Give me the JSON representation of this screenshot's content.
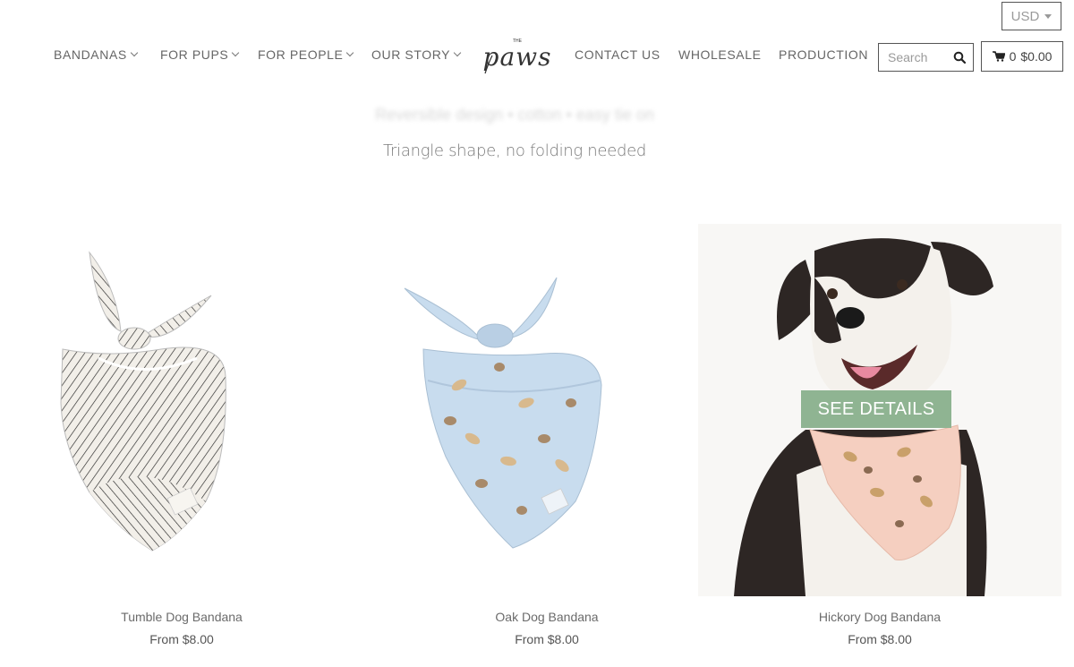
{
  "currency": {
    "label": "USD"
  },
  "nav": {
    "left": [
      {
        "label": "BANDANAS"
      },
      {
        "label": "FOR PUPS"
      },
      {
        "label": "FOR PEOPLE"
      },
      {
        "label": "OUR STORY"
      }
    ],
    "logo": {
      "small": "THE",
      "main": "paws"
    },
    "right": [
      {
        "label": "CONTACT US"
      },
      {
        "label": "WHOLESALE"
      },
      {
        "label": "PRODUCTION"
      }
    ],
    "search_placeholder": "Search",
    "cart": {
      "count": "0",
      "total": "$0.00"
    }
  },
  "section": {
    "faded_heading": "Reversible design • cotton • easy tie on",
    "subtitle": "Triangle shape, no folding needed"
  },
  "products": [
    {
      "name": "Tumble Dog Bandana",
      "price": "From $8.00"
    },
    {
      "name": "Oak Dog Bandana",
      "price": "From $8.00"
    },
    {
      "name": "Hickory Dog Bandana",
      "price": "From $8.00",
      "button": "SEE DETAILS"
    }
  ],
  "colors": {
    "accent": "#8fb492",
    "oak": "#c8dcee",
    "hickory": "#f5cfc0",
    "tumble": "#f2efe9"
  }
}
